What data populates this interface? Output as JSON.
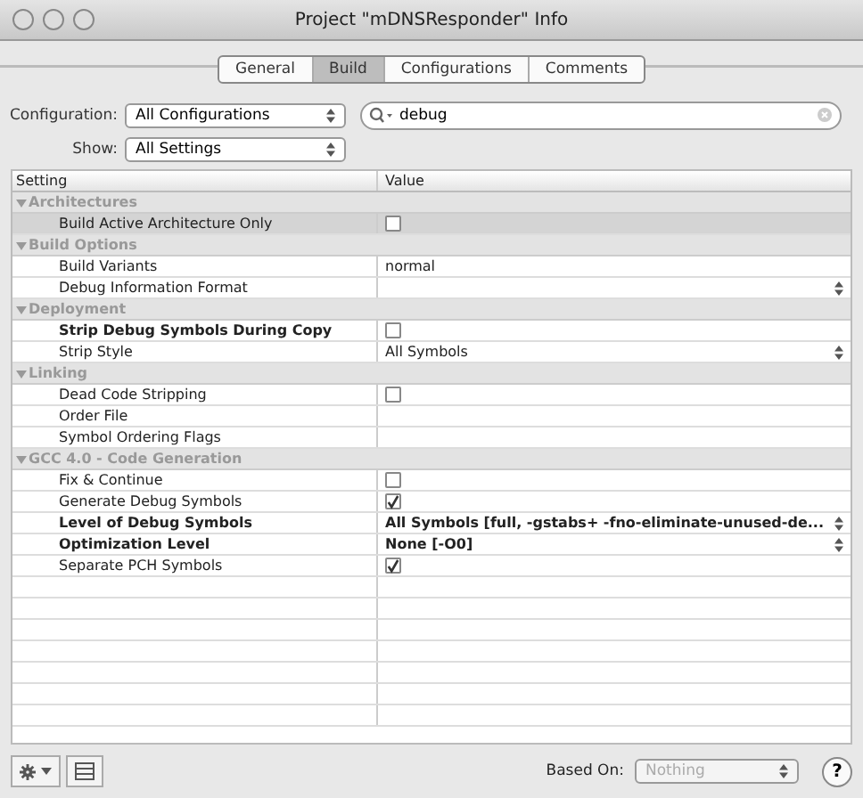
{
  "window": {
    "title": "Project \"mDNSResponder\" Info"
  },
  "tabs": [
    {
      "label": "General",
      "selected": false
    },
    {
      "label": "Build",
      "selected": true
    },
    {
      "label": "Configurations",
      "selected": false
    },
    {
      "label": "Comments",
      "selected": false
    }
  ],
  "configuration": {
    "label": "Configuration:",
    "value": "All Configurations"
  },
  "show": {
    "label": "Show:",
    "value": "All Settings"
  },
  "search": {
    "value": "debug"
  },
  "table": {
    "columns": [
      "Setting",
      "Value"
    ],
    "groups": [
      {
        "name": "Architectures",
        "expanded": true,
        "children": [
          {
            "name": "Build Active Architecture Only",
            "bold": false,
            "selected": true,
            "enabled": true,
            "kind": "checkbox",
            "checked": false
          }
        ]
      },
      {
        "name": "Build Options",
        "expanded": true,
        "children": [
          {
            "name": "Build Variants",
            "bold": false,
            "selected": false,
            "enabled": true,
            "kind": "text",
            "value": "normal"
          },
          {
            "name": "Debug Information Format",
            "bold": false,
            "selected": false,
            "enabled": true,
            "kind": "popup"
          }
        ]
      },
      {
        "name": "Deployment",
        "expanded": true,
        "children": [
          {
            "name": "Strip Debug Symbols During Copy",
            "bold": true,
            "selected": false,
            "enabled": true,
            "kind": "checkbox",
            "checked": false
          },
          {
            "name": "Strip Style",
            "bold": false,
            "selected": false,
            "enabled": true,
            "kind": "popup",
            "value": "All Symbols"
          }
        ]
      },
      {
        "name": "Linking",
        "expanded": true,
        "children": [
          {
            "name": "Dead Code Stripping",
            "bold": false,
            "selected": false,
            "enabled": true,
            "kind": "checkbox",
            "checked": false
          },
          {
            "name": "Order File",
            "bold": false,
            "selected": false,
            "enabled": true,
            "kind": "text"
          },
          {
            "name": "Symbol Ordering Flags",
            "bold": false,
            "selected": false,
            "enabled": true,
            "kind": "text"
          }
        ]
      },
      {
        "name": "GCC 4.0 - Code Generation",
        "expanded": true,
        "children": [
          {
            "name": "Fix & Continue",
            "bold": false,
            "selected": false,
            "enabled": true,
            "kind": "checkbox",
            "checked": false
          },
          {
            "name": "Generate Debug Symbols",
            "bold": false,
            "selected": false,
            "enabled": true,
            "kind": "checkbox",
            "checked": true
          },
          {
            "name": "Level of Debug Symbols",
            "bold": true,
            "selected": false,
            "enabled": true,
            "kind": "popup",
            "value": "All Symbols [full, -gstabs+ -fno-eliminate-unused-de..."
          },
          {
            "name": "Optimization Level",
            "bold": true,
            "selected": false,
            "enabled": true,
            "kind": "popup",
            "value": "None [-O0]"
          },
          {
            "name": "Separate PCH Symbols",
            "bold": false,
            "selected": false,
            "enabled": true,
            "kind": "checkbox",
            "checked": true
          }
        ]
      }
    ]
  },
  "footer": {
    "based_on_label": "Based On:",
    "based_on_value": "Nothing",
    "based_on_disabled": true,
    "help": "?"
  }
}
